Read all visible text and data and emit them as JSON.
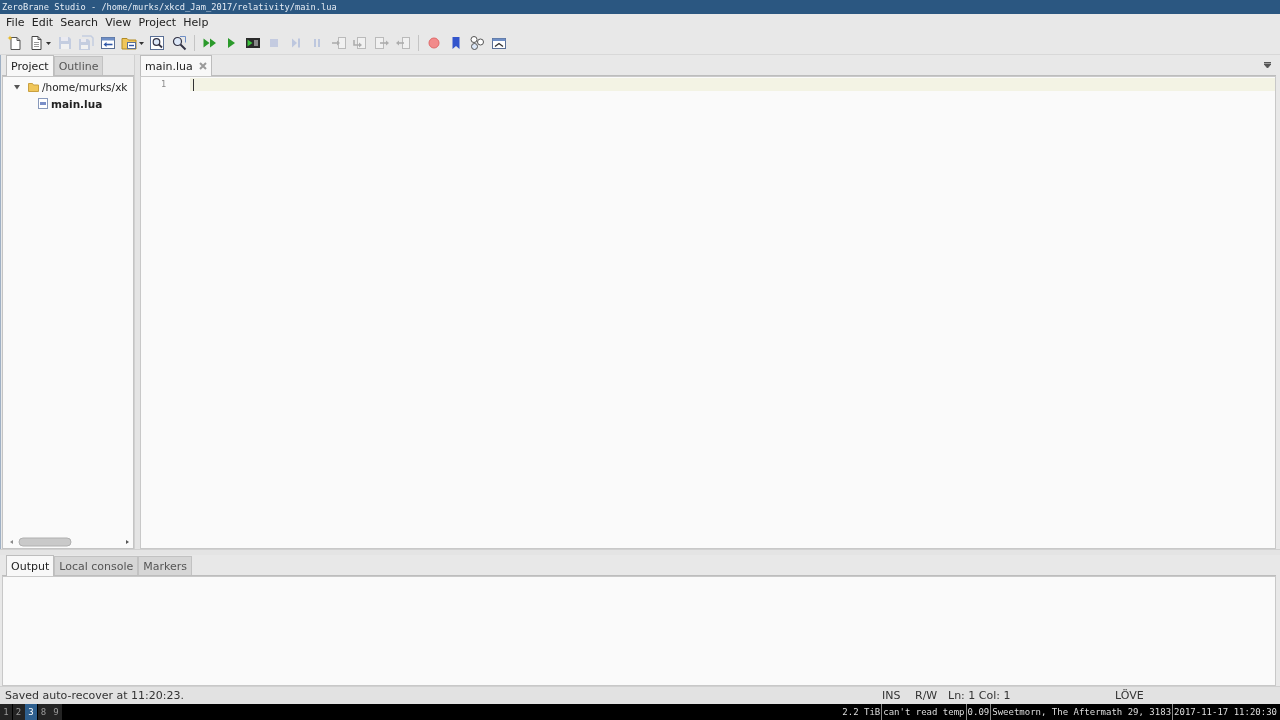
{
  "window": {
    "title": "ZeroBrane Studio - /home/murks/xkcd_Jam_2017/relativity/main.lua"
  },
  "menu": [
    "File",
    "Edit",
    "Search",
    "View",
    "Project",
    "Help"
  ],
  "toolbar": {
    "groups": [
      [
        {
          "kind": "new",
          "disabled": false
        },
        {
          "kind": "open",
          "disabled": false,
          "dropdown": true
        },
        {
          "kind": "save",
          "disabled": true
        },
        {
          "kind": "saveall",
          "disabled": true
        },
        {
          "kind": "projectfile",
          "disabled": false
        },
        {
          "kind": "projectdir",
          "disabled": false,
          "dropdown": true
        },
        {
          "kind": "find",
          "disabled": false
        },
        {
          "kind": "findfiles",
          "disabled": false
        }
      ],
      [
        {
          "kind": "debug",
          "disabled": false
        },
        {
          "kind": "run",
          "disabled": false
        },
        {
          "kind": "runnow",
          "disabled": false
        },
        {
          "kind": "stop",
          "disabled": true
        },
        {
          "kind": "continue",
          "disabled": true
        },
        {
          "kind": "break",
          "disabled": true
        },
        {
          "kind": "stepinto",
          "disabled": true
        },
        {
          "kind": "stepover",
          "disabled": true
        },
        {
          "kind": "stepout",
          "disabled": true
        },
        {
          "kind": "runto",
          "disabled": true
        }
      ],
      [
        {
          "kind": "breakpoint",
          "disabled": false
        },
        {
          "kind": "bookmark",
          "disabled": false
        },
        {
          "kind": "watch",
          "disabled": false
        },
        {
          "kind": "stack",
          "disabled": false
        }
      ]
    ]
  },
  "left_panel": {
    "tabs": [
      {
        "label": "Project",
        "selected": true
      },
      {
        "label": "Outline",
        "selected": false
      }
    ],
    "tree": [
      {
        "label": "/home/murks/xk",
        "kind": "folder",
        "expanded": true,
        "children": [
          {
            "label": "main.lua",
            "kind": "file",
            "active": true
          }
        ]
      }
    ]
  },
  "editor": {
    "tabs": [
      {
        "label": "main.lua",
        "selected": true
      }
    ],
    "lines": [
      {
        "number": "1",
        "current": true
      }
    ]
  },
  "bottom_panel": {
    "tabs": [
      {
        "label": "Output",
        "selected": true
      },
      {
        "label": "Local console",
        "selected": false
      },
      {
        "label": "Markers",
        "selected": false
      }
    ]
  },
  "status_bar": {
    "message": "Saved auto-recover at 11:20:23.",
    "fields": [
      "INS",
      "R/W",
      "Ln: 1 Col: 1",
      "LÖVE"
    ]
  },
  "taskbar": {
    "workspaces": [
      {
        "label": "1",
        "selected": false
      },
      {
        "label": "2",
        "selected": false
      },
      {
        "label": "3",
        "selected": true
      },
      {
        "label": "8",
        "selected": false
      },
      {
        "label": "9",
        "selected": false
      }
    ],
    "status": [
      "2.2 TiB",
      "can't read temp",
      "0.09",
      "Sweetmorn, The Aftermath 29, 3183",
      "2017-11-17 11:20:30"
    ]
  }
}
